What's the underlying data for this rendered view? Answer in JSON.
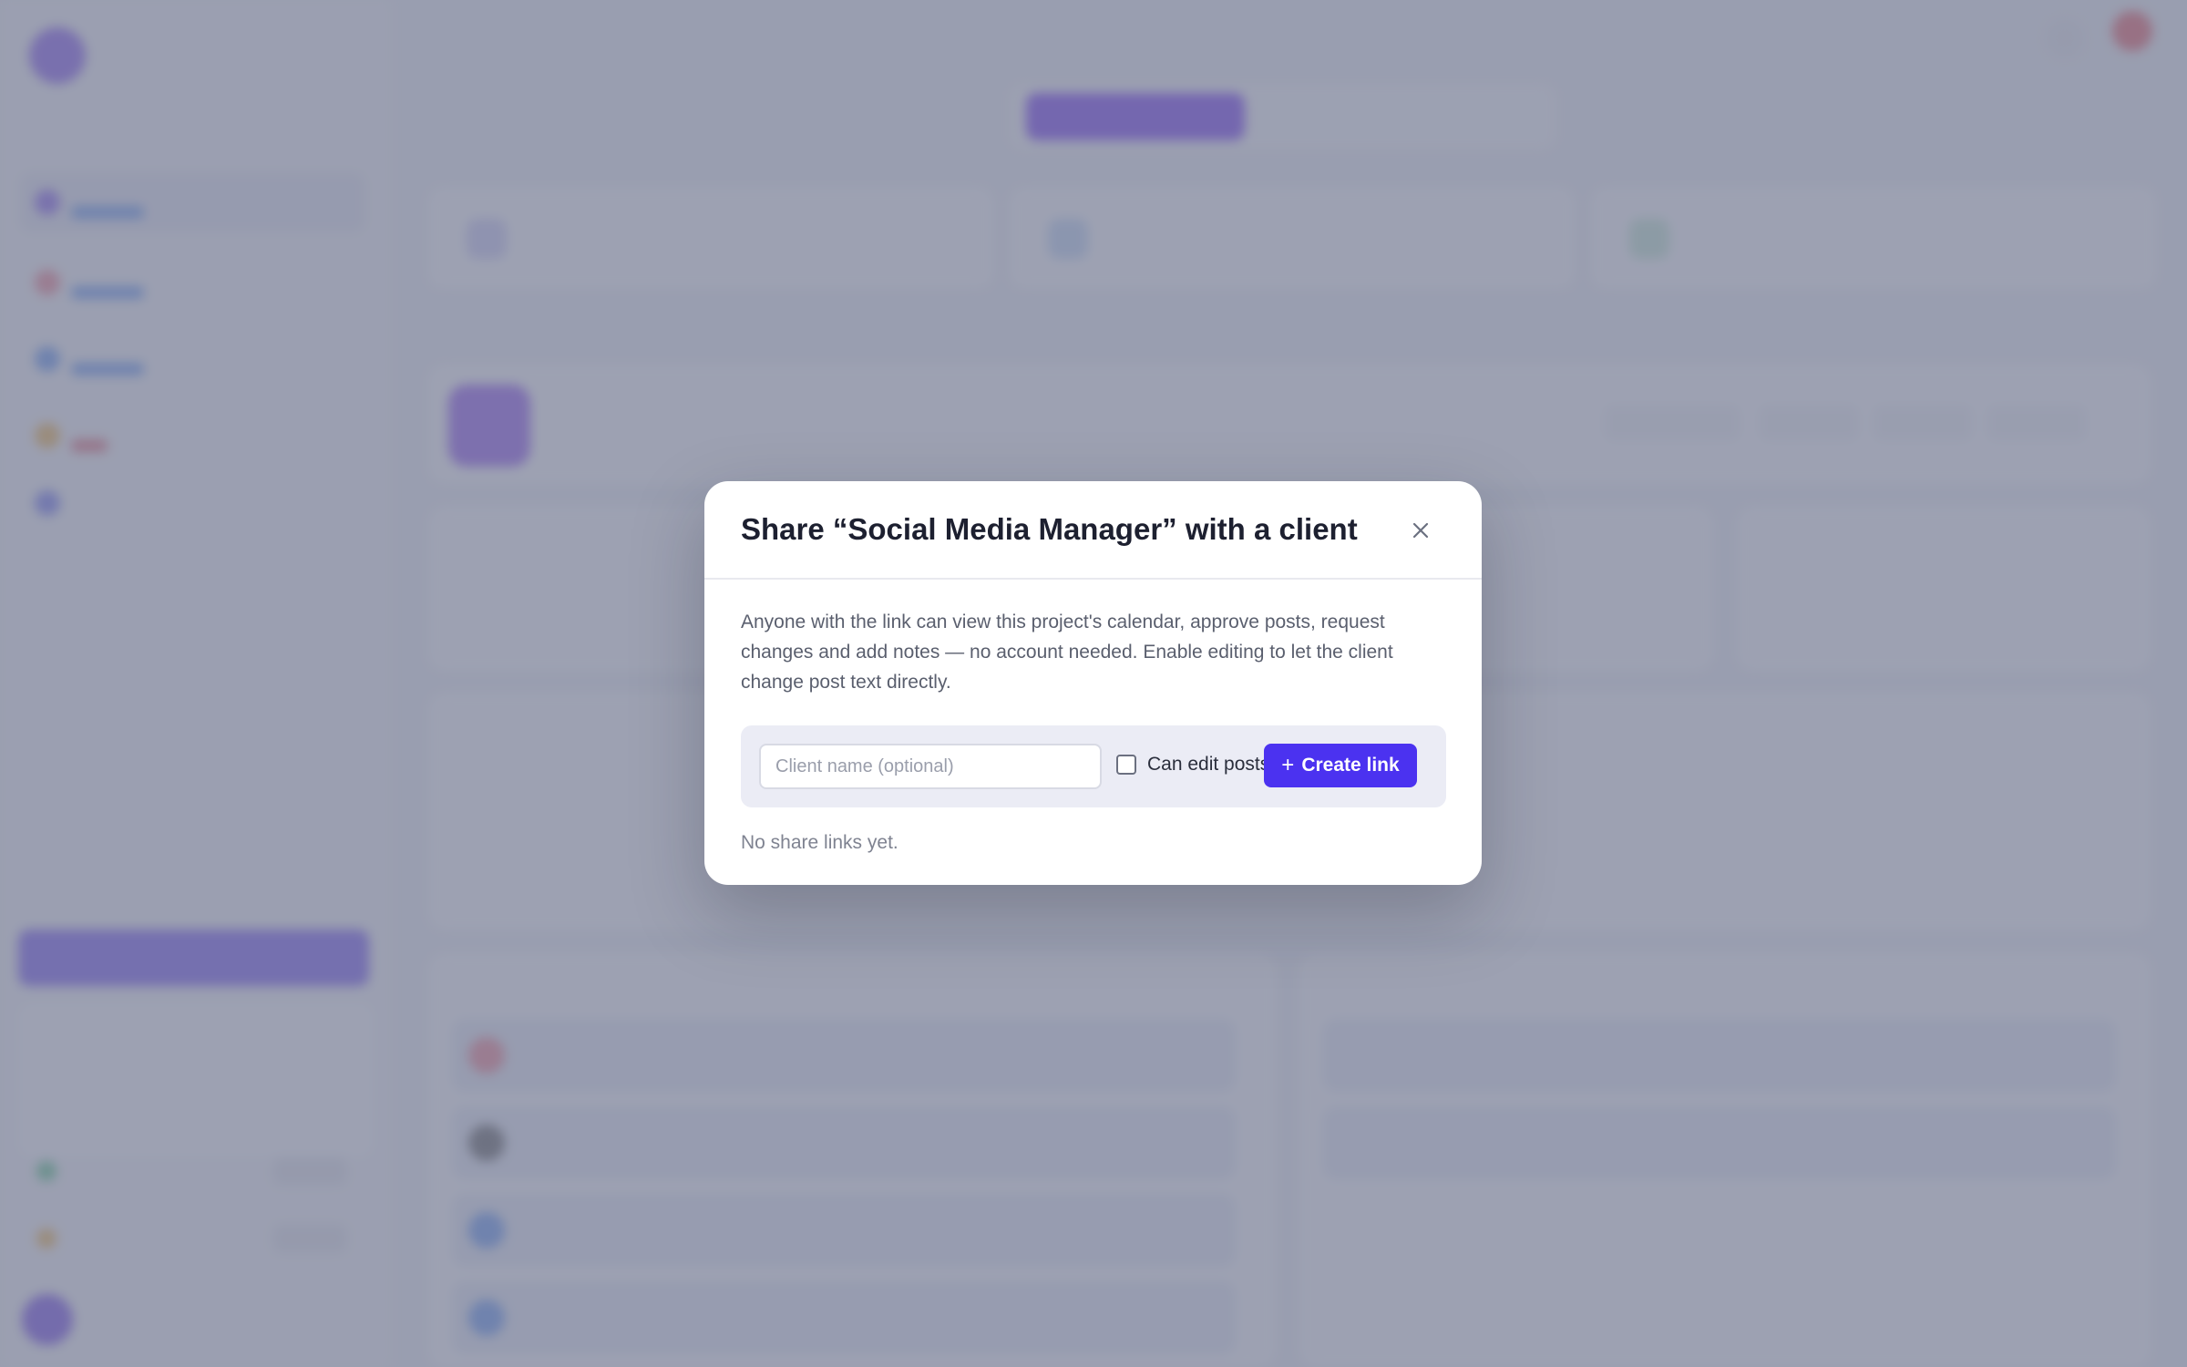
{
  "modal": {
    "title": "Share “Social Media Manager” with a client",
    "close_icon": "close-icon",
    "description": "Anyone with the link can view this project's calendar, approve posts, request changes and add notes — no account needed. Enable editing to let the client change post text directly.",
    "client_name": {
      "value": "",
      "placeholder": "Client name (optional)"
    },
    "can_edit": {
      "label": "Can edit posts",
      "checked": false
    },
    "create_button": {
      "icon": "plus-icon",
      "label": "Create link"
    },
    "empty_state": "No share links yet."
  },
  "background": {
    "project_name": "Social Media Manager"
  },
  "colors": {
    "accent": "#4b32f0",
    "overlay": "#787e94",
    "modal_bg": "#ffffff"
  }
}
